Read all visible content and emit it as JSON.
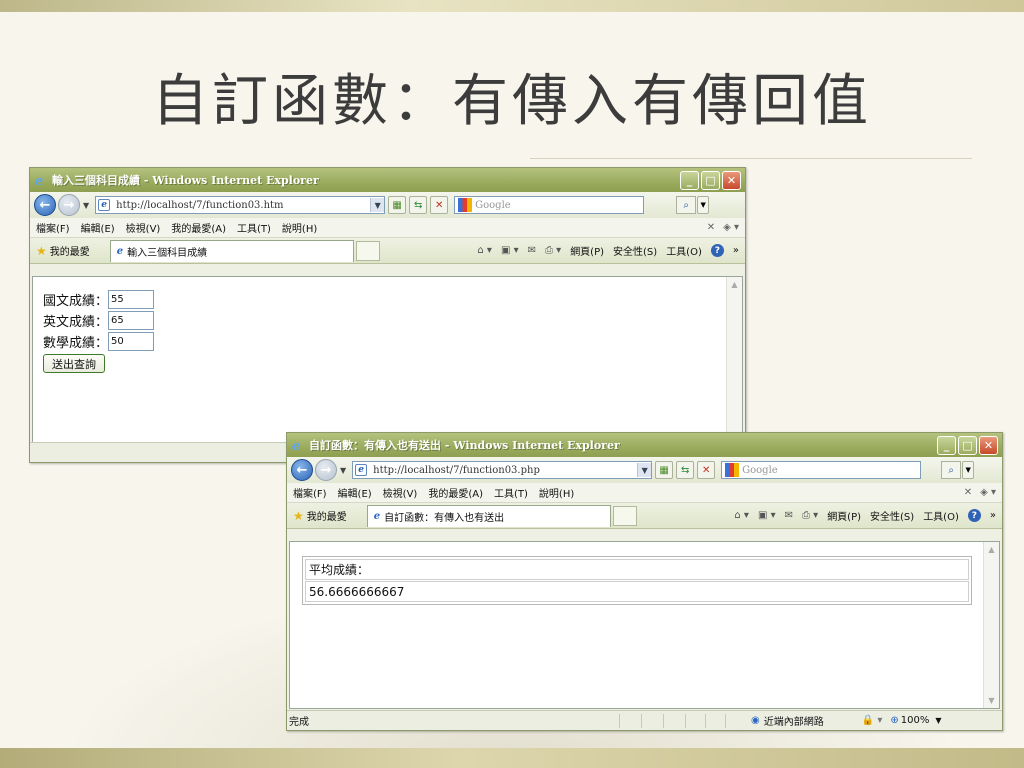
{
  "slide": {
    "title": "自訂函數：有傳入有傳回值"
  },
  "window1": {
    "title": "輸入三個科目成績 - Windows Internet Explorer",
    "address": "http://localhost/7/function03.htm",
    "search_placeholder": "Google",
    "menu": [
      "檔案(F)",
      "編輯(E)",
      "檢視(V)",
      "我的最愛(A)",
      "工具(T)",
      "說明(H)"
    ],
    "favorites_label": "我的最愛",
    "tab_label": "輸入三個科目成績",
    "command_bar": {
      "page": "網頁(P)",
      "safety": "安全性(S)",
      "tools": "工具(O)"
    },
    "form": {
      "rows": [
        {
          "label": "國文成績：",
          "value": "55"
        },
        {
          "label": "英文成績：",
          "value": "65"
        },
        {
          "label": "數學成績：",
          "value": "50"
        }
      ],
      "submit_label": "送出查詢"
    }
  },
  "window2": {
    "title": "自訂函數：有傳入也有送出 - Windows Internet Explorer",
    "address": "http://localhost/7/function03.php",
    "search_placeholder": "Google",
    "menu": [
      "檔案(F)",
      "編輯(E)",
      "檢視(V)",
      "我的最愛(A)",
      "工具(T)",
      "說明(H)"
    ],
    "favorites_label": "我的最愛",
    "tab_label": "自訂函數：有傳入也有送出",
    "command_bar": {
      "page": "網頁(P)",
      "safety": "安全性(S)",
      "tools": "工具(O)"
    },
    "result": {
      "header": "平均成績：",
      "value": "56.6666666667"
    },
    "status": {
      "text": "完成",
      "zone": "近端內部網路",
      "zoom": "100%"
    }
  },
  "colors": {
    "titlebar": "#9aab5e",
    "close_button": "#c8492c",
    "accent_blue": "#2a64b8"
  }
}
